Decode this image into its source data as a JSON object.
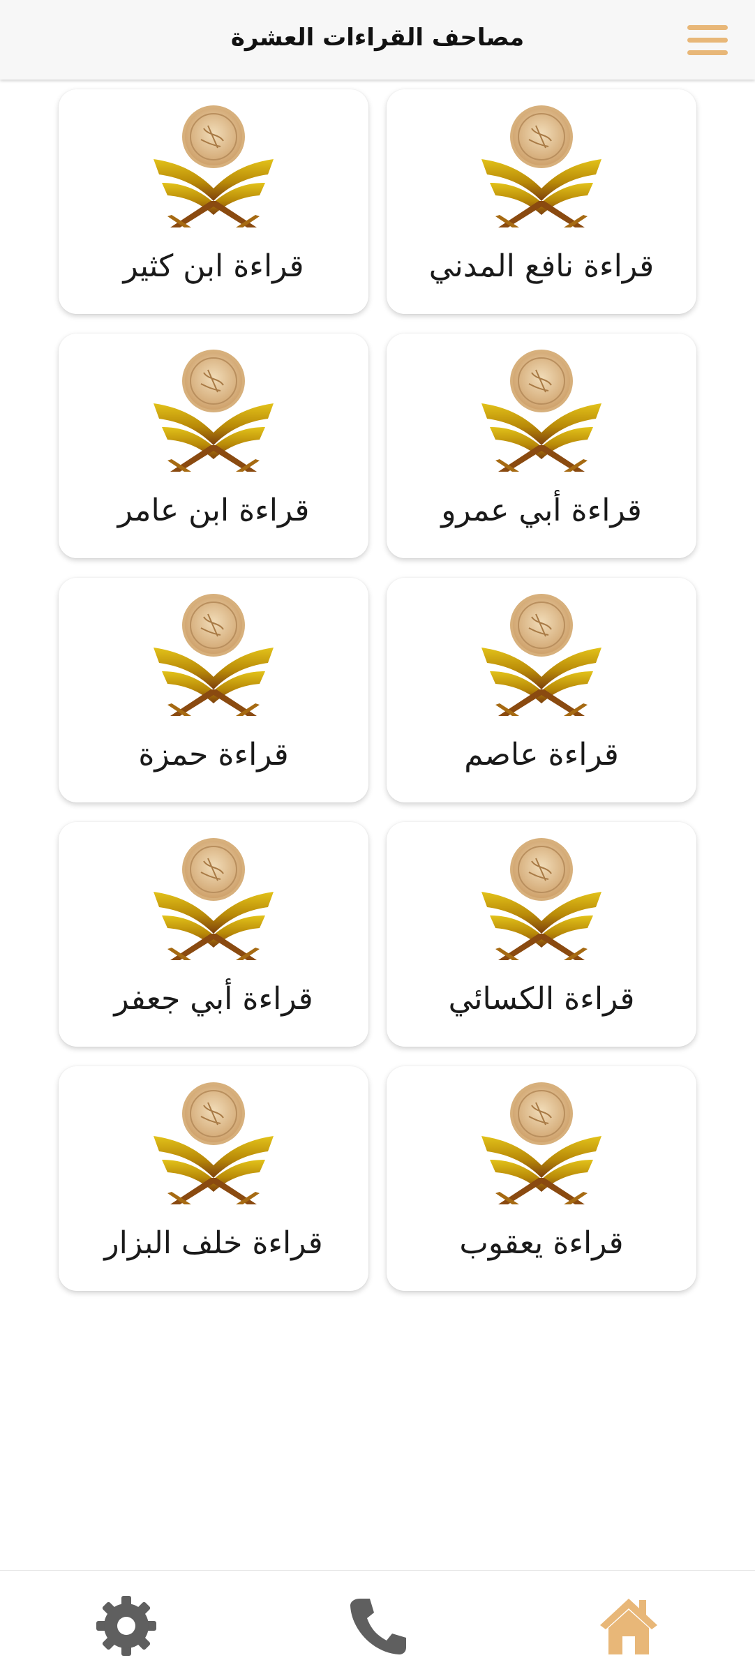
{
  "header": {
    "title": "مصاحف القراءات العشرة",
    "menu_icon": "hamburger-menu-icon"
  },
  "readings": [
    {
      "label": "قراءة نافع المدني"
    },
    {
      "label": "قراءة ابن كثير"
    },
    {
      "label": "قراءة أبي عمرو"
    },
    {
      "label": "قراءة ابن عامر"
    },
    {
      "label": "قراءة عاصم"
    },
    {
      "label": "قراءة حمزة"
    },
    {
      "label": "قراءة الكسائي"
    },
    {
      "label": "قراءة أبي جعفر"
    },
    {
      "label": "قراءة يعقوب"
    },
    {
      "label": "قراءة خلف البزار"
    }
  ],
  "bottom_nav": {
    "items": [
      {
        "icon": "home-icon",
        "active": true
      },
      {
        "icon": "phone-icon",
        "active": false
      },
      {
        "icon": "gear-icon",
        "active": false
      }
    ]
  },
  "colors": {
    "accent": "#e8b778",
    "header_bg": "#f7f7f7",
    "icon_gray": "#5f5f5f",
    "emblem_gold": "#c7a100",
    "emblem_brown": "#8a4a10"
  }
}
